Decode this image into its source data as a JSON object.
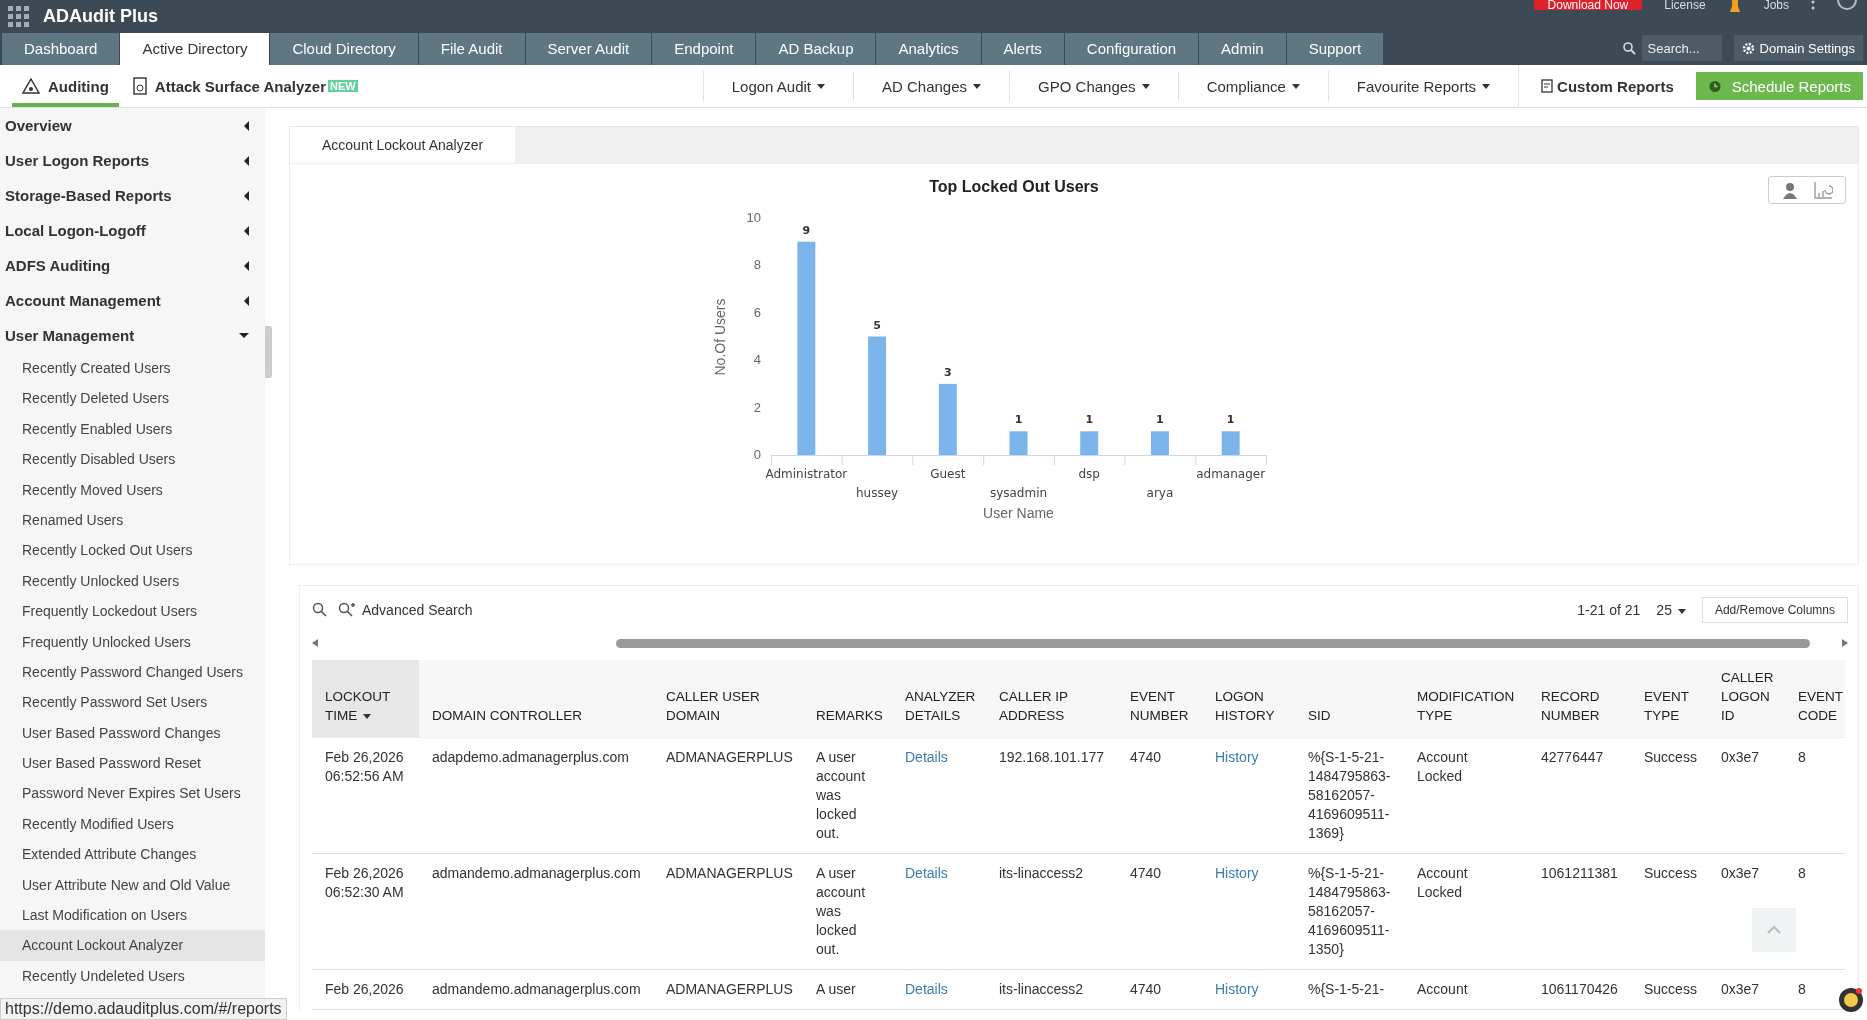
{
  "top_bar": {
    "app_title": "ADAudit Plus",
    "actions": [
      "Download Now",
      "License",
      "Jobs"
    ]
  },
  "main_tabs": [
    {
      "label": "Dashboard",
      "selected": false
    },
    {
      "label": "Active Directory",
      "selected": true
    },
    {
      "label": "Cloud Directory",
      "selected": false
    },
    {
      "label": "File Audit",
      "selected": false
    },
    {
      "label": "Server Audit",
      "selected": false
    },
    {
      "label": "Endpoint",
      "selected": false
    },
    {
      "label": "AD Backup",
      "selected": false
    },
    {
      "label": "Analytics",
      "selected": false
    },
    {
      "label": "Alerts",
      "selected": false
    },
    {
      "label": "Configuration",
      "selected": false
    },
    {
      "label": "Admin",
      "selected": false
    },
    {
      "label": "Support",
      "selected": false
    }
  ],
  "search": {
    "placeholder": "Search..."
  },
  "domain_settings": "Domain Settings",
  "sub_nav": {
    "tabs": [
      {
        "label": "Auditing",
        "selected": true
      },
      {
        "label": "Attack Surface Analyzer",
        "badge": "NEW",
        "selected": false
      }
    ],
    "menus": [
      "Logon Audit",
      "AD Changes",
      "GPO Changes",
      "Compliance",
      "Favourite Reports"
    ],
    "custom_reports": "Custom Reports",
    "schedule_reports": "Schedule Reports"
  },
  "sidebar": {
    "items": [
      {
        "label": "Overview",
        "expanded": false
      },
      {
        "label": "User Logon Reports",
        "expanded": false
      },
      {
        "label": "Storage-Based Reports",
        "expanded": false
      },
      {
        "label": "Local Logon-Logoff",
        "expanded": false
      },
      {
        "label": "ADFS Auditing",
        "expanded": false
      },
      {
        "label": "Account Management",
        "expanded": false
      },
      {
        "label": "User Management",
        "expanded": true,
        "children": [
          {
            "label": "Recently Created Users",
            "selected": false
          },
          {
            "label": "Recently Deleted Users",
            "selected": false
          },
          {
            "label": "Recently Enabled Users",
            "selected": false
          },
          {
            "label": "Recently Disabled Users",
            "selected": false
          },
          {
            "label": "Recently Moved Users",
            "selected": false
          },
          {
            "label": "Renamed Users",
            "selected": false
          },
          {
            "label": "Recently Locked Out Users",
            "selected": false
          },
          {
            "label": "Recently Unlocked Users",
            "selected": false
          },
          {
            "label": "Frequently Lockedout Users",
            "selected": false
          },
          {
            "label": "Frequently Unlocked Users",
            "selected": false
          },
          {
            "label": "Recently Password Changed Users",
            "selected": false
          },
          {
            "label": "Recently Password Set Users",
            "selected": false
          },
          {
            "label": "User Based Password Changes",
            "selected": false
          },
          {
            "label": "User Based Password Reset",
            "selected": false
          },
          {
            "label": "Password Never Expires Set Users",
            "selected": false
          },
          {
            "label": "Recently Modified Users",
            "selected": false
          },
          {
            "label": "Extended Attribute Changes",
            "selected": false
          },
          {
            "label": "User Attribute New and Old Value",
            "selected": false
          },
          {
            "label": "Last Modification on Users",
            "selected": false
          },
          {
            "label": "Account Lockout Analyzer",
            "selected": true
          },
          {
            "label": "Recently Undeleted Users",
            "selected": false
          }
        ]
      }
    ]
  },
  "report": {
    "tab": "Account Lockout Analyzer",
    "chart_data": {
      "type": "bar",
      "title": "Top Locked Out Users",
      "xlabel": "User Name",
      "ylabel": "No.Of Users",
      "categories": [
        "Administrator",
        "hussey",
        "Guest",
        "sysadmin",
        "dsp",
        "arya",
        "admanager"
      ],
      "series": [
        {
          "color": "#7cb5ec",
          "values": [
            9,
            5,
            3,
            1,
            1,
            1,
            1
          ]
        }
      ],
      "ylim": [
        0,
        10
      ],
      "yticks": [
        0,
        2,
        4,
        6,
        8,
        10
      ],
      "data_labels": true
    }
  },
  "table": {
    "search_label": "Advanced Search",
    "pagination": "1-21 of 21",
    "page_size": "25",
    "columns_button": "Add/Remove Columns",
    "columns": [
      {
        "label": "LOCKOUT TIME",
        "sorted": true,
        "kind": "text"
      },
      {
        "label": "DOMAIN CONTROLLER",
        "sorted": false,
        "kind": "text"
      },
      {
        "label": "CALLER USER DOMAIN",
        "sorted": false,
        "kind": "text"
      },
      {
        "label": "REMARKS",
        "sorted": false,
        "kind": "text"
      },
      {
        "label": "ANALYZER DETAILS",
        "sorted": false,
        "kind": "link"
      },
      {
        "label": "CALLER IP ADDRESS",
        "sorted": false,
        "kind": "text"
      },
      {
        "label": "EVENT NUMBER",
        "sorted": false,
        "kind": "text"
      },
      {
        "label": "LOGON HISTORY",
        "sorted": false,
        "kind": "link"
      },
      {
        "label": "SID",
        "sorted": false,
        "kind": "text"
      },
      {
        "label": "MODIFICATION TYPE",
        "sorted": false,
        "kind": "text"
      },
      {
        "label": "RECORD NUMBER",
        "sorted": false,
        "kind": "text"
      },
      {
        "label": "EVENT TYPE",
        "sorted": false,
        "kind": "text"
      },
      {
        "label": "CALLER LOGON ID",
        "sorted": false,
        "kind": "text"
      },
      {
        "label": "EVENT CODE",
        "sorted": false,
        "kind": "text"
      }
    ],
    "rows": [
      [
        "Feb 26,2026 06:52:56 AM",
        "adapdemo.admanagerplus.com",
        "ADMANAGERPLUS",
        "A user account was locked out.",
        "Details",
        "192.168.101.177",
        "4740",
        "History",
        "%{S-1-5-21-1484795863-58162057-4169609511-1369}",
        "Account Locked",
        "42776447",
        "Success",
        "0x3e7",
        "8"
      ],
      [
        "Feb 26,2026 06:52:30 AM",
        "admandemo.admanagerplus.com",
        "ADMANAGERPLUS",
        "A user account was locked out.",
        "Details",
        "its-linaccess2",
        "4740",
        "History",
        "%{S-1-5-21-1484795863-58162057-4169609511-1350}",
        "Account Locked",
        "1061211381",
        "Success",
        "0x3e7",
        "8"
      ],
      [
        "Feb 26,2026",
        "admandemo.admanagerplus.com",
        "ADMANAGERPLUS",
        "A user",
        "Details",
        "its-linaccess2",
        "4740",
        "History",
        "%{S-1-5-21-",
        "Account",
        "1061170426",
        "Success",
        "0x3e7",
        "8"
      ]
    ]
  },
  "status_url": "https://demo.adauditplus.com/#/reports"
}
